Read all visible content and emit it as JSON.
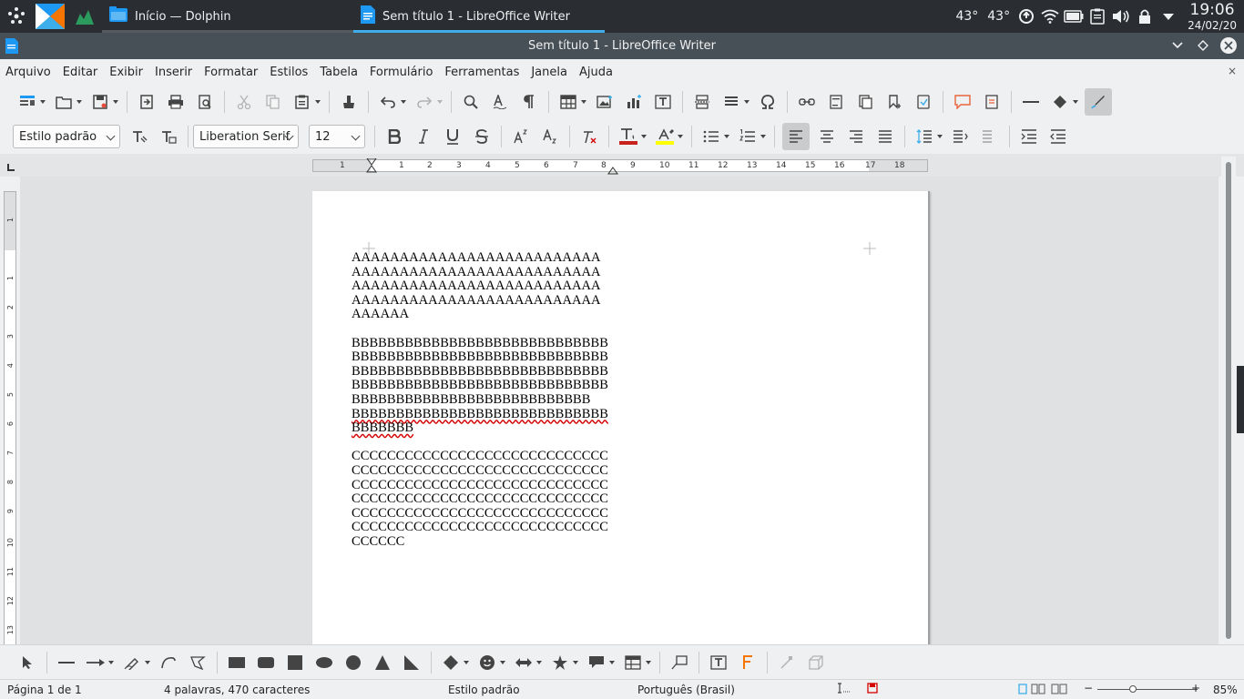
{
  "taskbar": {
    "tasks": [
      {
        "label": "Início — Dolphin"
      },
      {
        "label": "Sem título 1 - LibreOffice Writer"
      }
    ],
    "temp1": "43°",
    "temp2": "43°",
    "time": "19:06",
    "date": "24/02/20"
  },
  "window": {
    "title": "Sem título 1 - LibreOffice Writer"
  },
  "menu": {
    "items": [
      "Arquivo",
      "Editar",
      "Exibir",
      "Inserir",
      "Formatar",
      "Estilos",
      "Tabela",
      "Formulário",
      "Ferramentas",
      "Janela",
      "Ajuda"
    ],
    "close": "×"
  },
  "formatting": {
    "paragraph_style": "Estilo padrão",
    "font_name": "Liberation Serif",
    "font_size": "12"
  },
  "ruler": {
    "h_ticks": [
      "1",
      "1",
      "2",
      "3",
      "4",
      "5",
      "6",
      "7",
      "8",
      "9",
      "10",
      "11",
      "12",
      "13",
      "14",
      "15",
      "16",
      "17",
      "18"
    ],
    "v_ticks": [
      "1",
      "1",
      "2",
      "3",
      "4",
      "5",
      "6",
      "7",
      "8",
      "9",
      "10",
      "11",
      "12",
      "13"
    ]
  },
  "document": {
    "paragraphs": [
      {
        "lines": [
          "AAAAAAAAAAAAAAAAAAAAAAAAAA",
          "AAAAAAAAAAAAAAAAAAAAAAAAAA",
          "AAAAAAAAAAAAAAAAAAAAAAAAAA",
          "AAAAAAAAAAAAAAAAAAAAAAAAAA",
          "AAAAAA"
        ]
      },
      {
        "lines": [
          "BBBBBBBBBBBBBBBBBBBBBBBBBBBBB",
          "BBBBBBBBBBBBBBBBBBBBBBBBBBBBB",
          "BBBBBBBBBBBBBBBBBBBBBBBBBBBBB",
          "BBBBBBBBBBBBBBBBBBBBBBBBBBBBB",
          "BBBBBBBBBBBBBBBBBBBBBBBBBBB",
          "BBBBBBBBBBBBBBBBBBBBBBBBBBBBB",
          "BBBBBBB"
        ]
      },
      {
        "lines": [
          "CCCCCCCCCCCCCCCCCCCCCCCCCCCCC",
          "CCCCCCCCCCCCCCCCCCCCCCCCCCCCC",
          "CCCCCCCCCCCCCCCCCCCCCCCCCCCCC",
          "CCCCCCCCCCCCCCCCCCCCCCCCCCCCC",
          "CCCCCCCCCCCCCCCCCCCCCCCCCCCCC",
          "CCCCCCCCCCCCCCCCCCCCCCCCCCCCC",
          "CCCCCC"
        ]
      }
    ]
  },
  "status": {
    "page": "Página 1 de 1",
    "words": "4 palavras, 470 caracteres",
    "style": "Estilo padrão",
    "language": "Português (Brasil)",
    "zoom": "85%",
    "zoom_minus": "−",
    "zoom_plus": "+"
  },
  "colors": {
    "font_color": "#c9211e",
    "highlight": "#ffff00",
    "accent": "#3daee9"
  }
}
